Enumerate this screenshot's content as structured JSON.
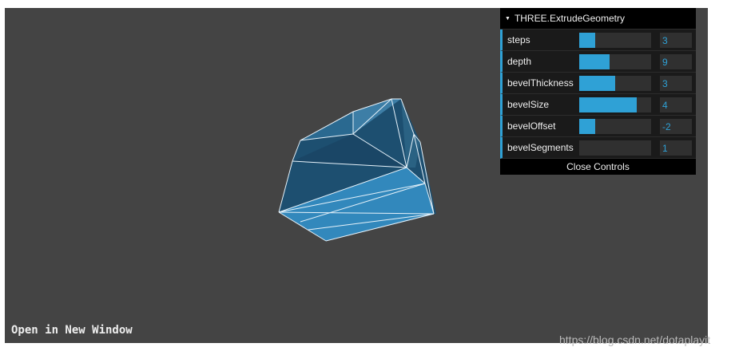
{
  "gui": {
    "title": "THREE.ExtrudeGeometry",
    "controls": [
      {
        "label": "steps",
        "value": "3",
        "fill": 0.22
      },
      {
        "label": "depth",
        "value": "9",
        "fill": 0.42
      },
      {
        "label": "bevelThickness",
        "value": "3",
        "fill": 0.5
      },
      {
        "label": "bevelSize",
        "value": "4",
        "fill": 0.8
      },
      {
        "label": "bevelOffset",
        "value": "-2",
        "fill": 0.22
      },
      {
        "label": "bevelSegments",
        "value": "1",
        "fill": 0.0
      }
    ],
    "close_label": "Close Controls"
  },
  "link": {
    "label": "Open in New Window"
  },
  "watermark": "https://blog.csdn.net/dotaplayit",
  "colors": {
    "viewport_bg": "#444444",
    "accent": "#2fa1d6",
    "mesh_dark": "#1a4a6b",
    "mesh_light": "#3288bc",
    "wire": "#e6f2fa"
  },
  "icons": {
    "gui_collapse": "triangle-down-icon"
  }
}
